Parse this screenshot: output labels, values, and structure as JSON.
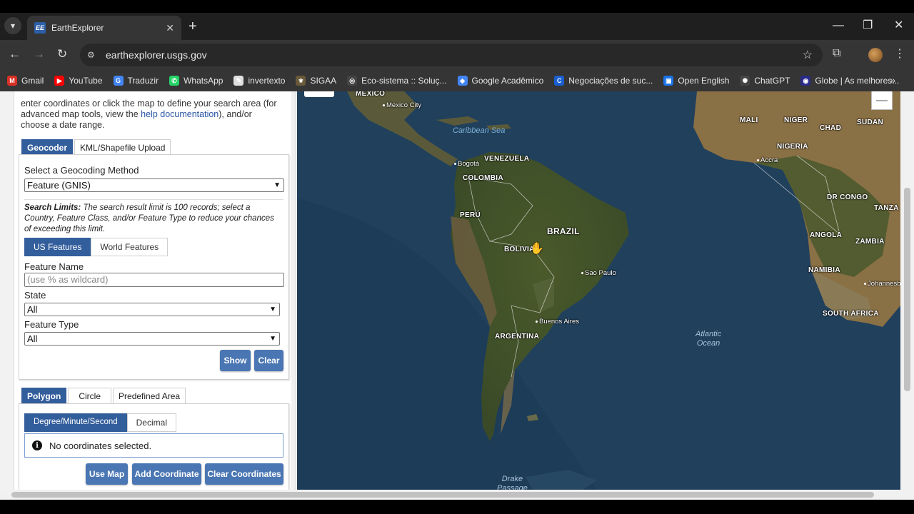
{
  "browser": {
    "tab_title": "EarthExplorer",
    "tab_favicon": "EE",
    "url": "earthexplorer.usgs.gov",
    "icons": {
      "tab_search": "chevron-down-icon",
      "new_tab": "+",
      "back": "←",
      "forward": "→",
      "reload": "↻",
      "minimize": "—",
      "restore": "❐",
      "close": "✕",
      "site_info": "⚙",
      "star": "☆",
      "extensions": "⧉",
      "menu": "⋮",
      "more": "»"
    }
  },
  "bookmarks": [
    {
      "label": "Gmail",
      "icon": "M",
      "color": "#d93025"
    },
    {
      "label": "YouTube",
      "icon": "▶",
      "color": "#ff0000"
    },
    {
      "label": "Traduzir",
      "icon": "G",
      "color": "#4285f4"
    },
    {
      "label": "WhatsApp",
      "icon": "✆",
      "color": "#25d366"
    },
    {
      "label": "invertexto",
      "icon": "✎",
      "color": "#e0e0e0"
    },
    {
      "label": "SIGAA",
      "icon": "⚜",
      "color": "#6a5a3a"
    },
    {
      "label": "Eco-sistema :: Soluç...",
      "icon": "◎",
      "color": "#444"
    },
    {
      "label": "Google Acadêmico",
      "icon": "◆",
      "color": "#4285f4"
    },
    {
      "label": "Negociações de suc...",
      "icon": "C",
      "color": "#1a5fd0"
    },
    {
      "label": "Open English",
      "icon": "▣",
      "color": "#1a73e8"
    },
    {
      "label": "ChatGPT",
      "icon": "✺",
      "color": "#444"
    },
    {
      "label": "Globe | As melhores...",
      "icon": "◉",
      "color": "#2a2a8a"
    }
  ],
  "panel": {
    "intro_line1": "enter coordinates or click the map to define your search area (for",
    "intro_line2a": "advanced map tools, view the ",
    "intro_link": "help documentation",
    "intro_line2b": "), and/or",
    "intro_line3": "choose a date range.",
    "search_tabs": [
      "Geocoder",
      "KML/Shapefile Upload"
    ],
    "geocoding_label": "Select a Geocoding Method",
    "geocoding_value": "Feature (GNIS)",
    "limits_title": "Search Limits:",
    "limits_text": " The search result limit is 100 records; select a Country, Feature Class, and/or Feature Type to reduce your chances of exceeding this limit.",
    "feature_tabs": [
      "US Features",
      "World Features"
    ],
    "feature_name_label": "Feature Name",
    "feature_name_placeholder": "(use % as wildcard)",
    "state_label": "State",
    "state_value": "All",
    "feature_type_label": "Feature Type",
    "feature_type_value": "All",
    "show_button": "Show",
    "clear_button": "Clear",
    "area_tabs": [
      "Polygon",
      "Circle",
      "Predefined Area"
    ],
    "coord_tabs": [
      "Degree/Minute/Second",
      "Decimal"
    ],
    "no_coords": "No coordinates selected.",
    "use_map_button": "Use Map",
    "add_coord_button": "Add Coordinate",
    "clear_coords_button": "Clear Coordinates"
  },
  "map": {
    "countries": [
      "MÉXICO",
      "VENEZUELA",
      "COLOMBIA",
      "PERÚ",
      "BRAZIL",
      "BOLIVIA",
      "ARGENTINA",
      "MALI",
      "NIGER",
      "CHAD",
      "SUDAN",
      "NIGERIA",
      "DR CONGO",
      "TANZA",
      "ANGOLA",
      "ZAMBIA",
      "NAMIBIA",
      "SOUTH AFRICA"
    ],
    "cities": [
      "Mexico City",
      "Bogotá",
      "Accra",
      "Sao Paulo",
      "Buenos Aires",
      "Johannesb"
    ],
    "seas": [
      "Caribbean Sea",
      "Atlantic",
      "Ocean",
      "Drake",
      "Passage"
    ],
    "zoom_out": "—",
    "cursor": "✋"
  }
}
